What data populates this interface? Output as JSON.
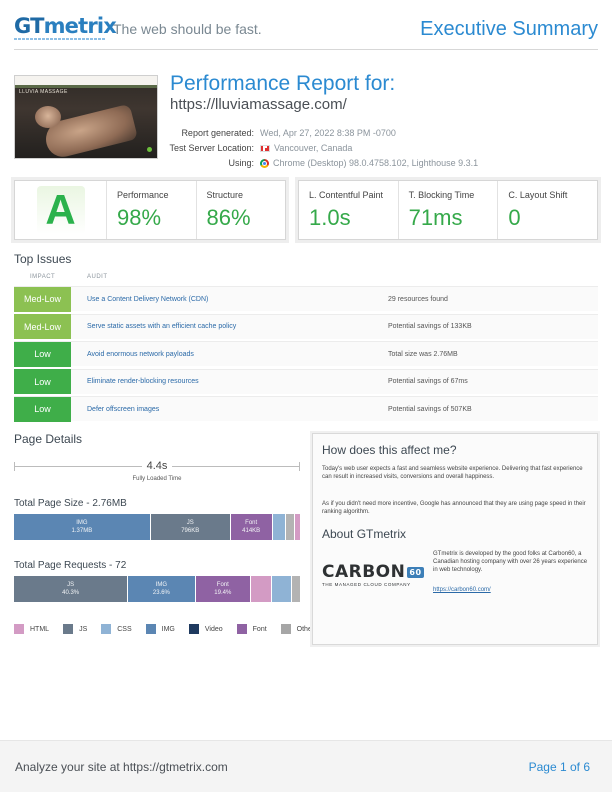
{
  "header": {
    "logo_gt": "GT",
    "logo_metrix": "metrix",
    "tagline": "The web should be fast.",
    "doc_title": "Executive Summary"
  },
  "thumbnail": {
    "site_name": "LLUVIA MASSAGE"
  },
  "report": {
    "title": "Performance Report for:",
    "url": "https://lluviamassage.com/",
    "meta": [
      {
        "label": "Report generated:",
        "value": "Wed, Apr 27, 2022 8:38 PM -0700",
        "icon": ""
      },
      {
        "label": "Test Server Location:",
        "value": "Vancouver, Canada",
        "icon": "canada-flag-icon"
      },
      {
        "label": "Using:",
        "value": "Chrome (Desktop) 98.0.4758.102, Lighthouse 9.3.1",
        "icon": "chrome-icon"
      }
    ]
  },
  "scores": {
    "grade": "A",
    "performance_label": "Performance",
    "performance_value": "98%",
    "structure_label": "Structure",
    "structure_value": "86%"
  },
  "web_vitals": [
    {
      "label": "L. Contentful Paint",
      "value": "1.0s"
    },
    {
      "label": "T. Blocking Time",
      "value": "71ms"
    },
    {
      "label": "C. Layout Shift",
      "value": "0"
    }
  ],
  "top_issues": {
    "title": "Top Issues",
    "col_impact": "IMPACT",
    "col_audit": "AUDIT",
    "rows": [
      {
        "impact": "Med-Low",
        "color": "#8cc152",
        "audit": "Use a Content Delivery Network (CDN)",
        "note": "29 resources found"
      },
      {
        "impact": "Med-Low",
        "color": "#8cc152",
        "audit": "Serve static assets with an efficient cache policy",
        "note": "Potential savings of 133KB"
      },
      {
        "impact": "Low",
        "color": "#3fae49",
        "audit": "Avoid enormous network payloads",
        "note": "Total size was 2.76MB"
      },
      {
        "impact": "Low",
        "color": "#3fae49",
        "audit": "Eliminate render-blocking resources",
        "note": "Potential savings of 67ms"
      },
      {
        "impact": "Low",
        "color": "#3fae49",
        "audit": "Defer offscreen images",
        "note": "Potential savings of 507KB"
      }
    ]
  },
  "page_details": {
    "title": "Page Details",
    "fully_loaded_value": "4.4s",
    "fully_loaded_label": "Fully Loaded Time",
    "size_title": "Total Page Size - 2.76MB",
    "size_segments": [
      {
        "type": "IMG",
        "value": "1.37MB",
        "fraction": 0.483,
        "color": "#5b86b3"
      },
      {
        "type": "JS",
        "value": "796KB",
        "fraction": 0.281,
        "color": "#6a7a8b"
      },
      {
        "type": "Font",
        "value": "414KB",
        "fraction": 0.146,
        "color": "#8f62a3"
      },
      {
        "type": "",
        "value": "",
        "fraction": 0.045,
        "color": "#8fb3d5"
      },
      {
        "type": "",
        "value": "",
        "fraction": 0.028,
        "color": "#b3b3b3"
      },
      {
        "type": "",
        "value": "",
        "fraction": 0.017,
        "color": "#d39bc4"
      }
    ],
    "requests_title": "Total Page Requests - 72",
    "request_segments": [
      {
        "type": "JS",
        "value": "40.3%",
        "fraction": 0.403,
        "color": "#6a7a8b"
      },
      {
        "type": "IMG",
        "value": "23.6%",
        "fraction": 0.236,
        "color": "#5b86b3"
      },
      {
        "type": "Font",
        "value": "19.4%",
        "fraction": 0.194,
        "color": "#8f62a3"
      },
      {
        "type": "",
        "value": "",
        "fraction": 0.07,
        "color": "#d39bc4"
      },
      {
        "type": "",
        "value": "",
        "fraction": 0.07,
        "color": "#8fb3d5"
      },
      {
        "type": "",
        "value": "",
        "fraction": 0.027,
        "color": "#b3b3b3"
      }
    ],
    "legend": [
      {
        "label": "HTML",
        "color": "#d39bc4"
      },
      {
        "label": "JS",
        "color": "#6a7a8b"
      },
      {
        "label": "CSS",
        "color": "#8fb3d5"
      },
      {
        "label": "IMG",
        "color": "#5b86b3"
      },
      {
        "label": "Video",
        "color": "#1f3a5f"
      },
      {
        "label": "Font",
        "color": "#8f62a3"
      },
      {
        "label": "Other",
        "color": "#a6a6a6"
      }
    ]
  },
  "info_panel": {
    "affect_title": "How does this affect me?",
    "affect_p1": "Today's web user expects a fast and seamless website experience. Delivering that fast experience can result in increased visits, conversions and overall happiness.",
    "affect_p2": "As if you didn't need more incentive, Google has announced that they are using page speed in their ranking algorithm.",
    "about_title": "About GTmetrix",
    "carbon_name": "CARBON",
    "carbon_num": "60",
    "carbon_sub": "THE MANAGED CLOUD COMPANY",
    "about_text": "GTmetrix is developed by the good folks at Carbon60, a Canadian hosting company with over 26 years experience in web technology.",
    "about_link": "https://carbon60.com/"
  },
  "footer": {
    "left": "Analyze your site at https://gtmetrix.com",
    "right": "Page 1 of 6"
  }
}
